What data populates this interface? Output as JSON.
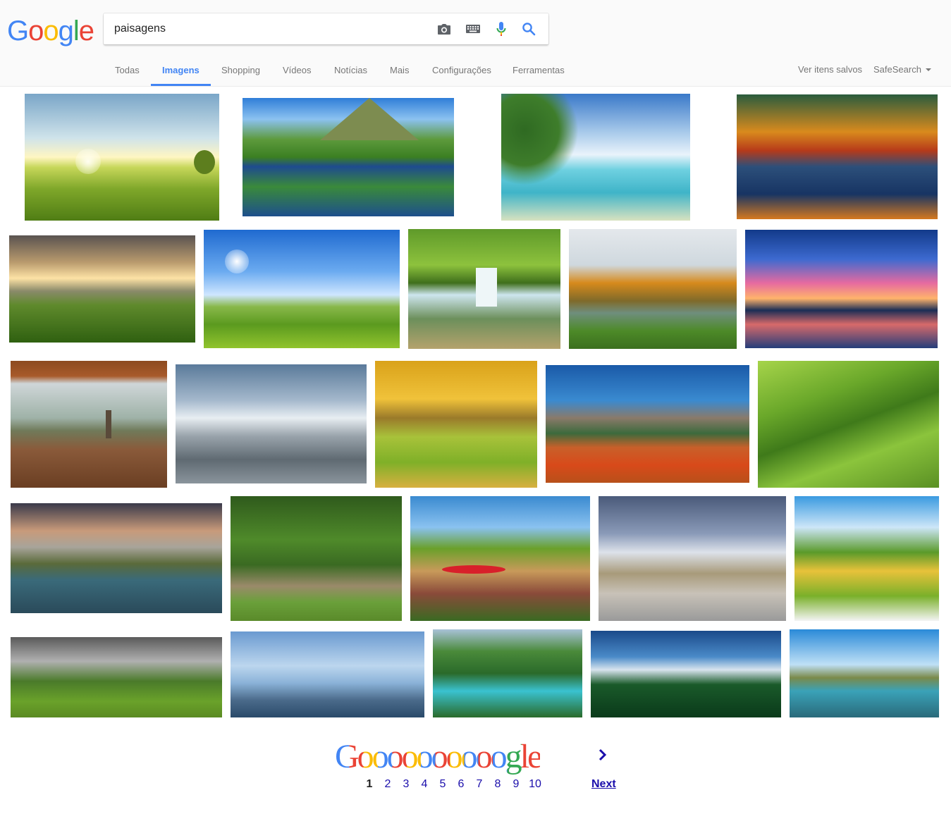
{
  "logo": {
    "letters": [
      "G",
      "o",
      "o",
      "g",
      "l",
      "e"
    ]
  },
  "search": {
    "query": "paisagens"
  },
  "toolbar_icons": [
    "camera-icon",
    "keyboard-icon",
    "microphone-icon",
    "search-icon"
  ],
  "tabs": [
    {
      "label": "Todas",
      "active": false
    },
    {
      "label": "Imagens",
      "active": true
    },
    {
      "label": "Shopping",
      "active": false
    },
    {
      "label": "Vídeos",
      "active": false
    },
    {
      "label": "Notícias",
      "active": false
    },
    {
      "label": "Mais",
      "active": false
    },
    {
      "label": "Configurações",
      "active": false
    },
    {
      "label": "Ferramentas",
      "active": false
    }
  ],
  "right_links": {
    "saved": "Ver itens salvos",
    "safesearch": "SafeSearch"
  },
  "colors": {
    "blue": "#4285f4",
    "red": "#ea4335",
    "yellow": "#fbbc05",
    "green": "#34a853",
    "link": "#1a0dab"
  },
  "pagination": {
    "logo": "Goooooooooogle",
    "pages": [
      "1",
      "2",
      "3",
      "4",
      "5",
      "6",
      "7",
      "8",
      "9",
      "10"
    ],
    "current": "1",
    "next_label": "Next"
  }
}
